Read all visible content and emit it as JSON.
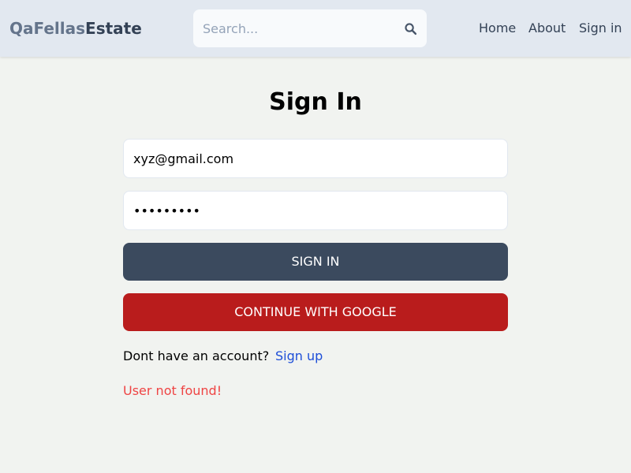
{
  "header": {
    "logo_part1": "QaFellas",
    "logo_part2": "Estate",
    "search_placeholder": "Search...",
    "nav": {
      "home": "Home",
      "about": "About",
      "sign_in": "Sign in"
    }
  },
  "main": {
    "title": "Sign In",
    "email_value": "xyz@gmail.com",
    "password_value": "xxxxxxxxx",
    "sign_in_button": "SIGN IN",
    "google_button": "CONTINUE WITH GOOGLE",
    "account_prompt": "Dont have an account?",
    "sign_up_link": "Sign up",
    "error_message": "User not found!"
  },
  "colors": {
    "header_bg": "#e2e8f0",
    "page_bg": "#f1f3f0",
    "sign_in_button_bg": "#3b4a5e",
    "google_button_bg": "#b91c1c",
    "link": "#1d4ed8",
    "error": "#ef4444"
  },
  "icons": {
    "search": "search-icon"
  }
}
